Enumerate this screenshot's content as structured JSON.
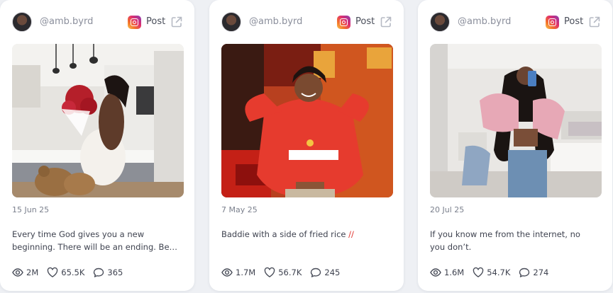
{
  "posts": [
    {
      "handle": "@amb.byrd",
      "platform_label": "Post",
      "date": "15 Jun 25",
      "caption": "Every time God gives you a new beginning. There will be an ending. Be…",
      "caption_emoji": "",
      "views": "2M",
      "likes": "65.5K",
      "comments": "365"
    },
    {
      "handle": "@amb.byrd",
      "platform_label": "Post",
      "date": "7 May 25",
      "caption": "Baddie with a side of fried rice",
      "caption_emoji": "//",
      "views": "1.7M",
      "likes": "56.7K",
      "comments": "245"
    },
    {
      "handle": "@amb.byrd",
      "platform_label": "Post",
      "date": "20 Jul 25",
      "caption": "If you know me from the internet, no you don’t.",
      "caption_emoji": "",
      "views": "1.6M",
      "likes": "54.7K",
      "comments": "274"
    }
  ],
  "icons": {
    "platform": "instagram-icon",
    "open": "external-link-icon",
    "views": "eye-icon",
    "likes": "heart-icon",
    "comments": "comment-icon"
  },
  "colors": {
    "background": "#eef0f4",
    "card": "#ffffff",
    "muted_text": "#8b8f9c",
    "body_text": "#3f4350"
  }
}
